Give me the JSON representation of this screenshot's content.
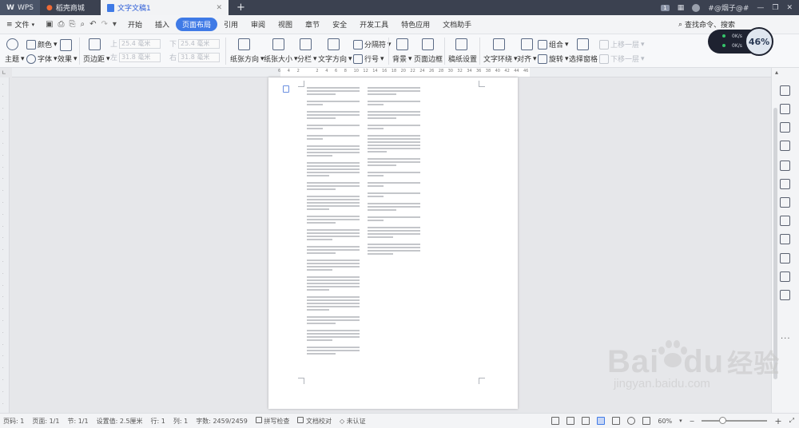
{
  "titlebar": {
    "tabs": [
      {
        "label": "WPS"
      },
      {
        "label": "稻壳商城"
      },
      {
        "label": "文字文稿1"
      }
    ],
    "badge": "1",
    "user": "#@烟子@#"
  },
  "menubar": {
    "file": "文件",
    "items": [
      "开始",
      "插入",
      "页面布局",
      "引用",
      "审阅",
      "视图",
      "章节",
      "安全",
      "开发工具",
      "特色应用",
      "文档助手"
    ],
    "search": "查找命令、搜索"
  },
  "ribbon": {
    "theme": "主题",
    "color": "颜色",
    "font": "字体",
    "effect": "效果",
    "margin": "页边距",
    "top_label": "上",
    "top_value": "25.4 毫米",
    "bottom_label": "下",
    "bottom_value": "25.4 毫米",
    "left_label": "左",
    "left_value": "31.8 毫米",
    "right_label": "右",
    "right_value": "31.8 毫米",
    "orientation": "纸张方向",
    "size": "纸张大小",
    "columns": "分栏",
    "text_direction": "文字方向",
    "separator": "分隔符",
    "line_number": "行号",
    "background": "背景",
    "page_border": "页面边框",
    "grid_paper": "稿纸设置",
    "text_wrap": "文字环绕",
    "align": "对齐",
    "group": "组合",
    "rotate": "旋转",
    "selection_pane": "选择窗格",
    "bring_forward": "上移一层",
    "send_backward": "下移一层"
  },
  "net_widget": {
    "up": "0K/s",
    "down": "0K/s",
    "percent": "46%"
  },
  "ruler": {
    "ticks": [
      "6",
      "4",
      "2",
      "2",
      "4",
      "6",
      "8",
      "10",
      "12",
      "14",
      "16",
      "18",
      "20",
      "22",
      "24",
      "26",
      "28",
      "30",
      "32",
      "34",
      "36",
      "38",
      "40",
      "42",
      "44",
      "46"
    ]
  },
  "statusbar": {
    "page_num": "页码: 1",
    "pages": "页面: 1/1",
    "section": "节: 1/1",
    "setting": "设置值: 2.5厘米",
    "row": "行: 1",
    "col": "列: 1",
    "words": "字数: 2459/2459",
    "spell": "拼写检查",
    "proof": "文档校对",
    "cert": "未认证",
    "zoom": "60%"
  },
  "watermark": {
    "brand": "Bai",
    "brand2": "du",
    "cn": "经验",
    "url": "jingyan.baidu.com"
  }
}
